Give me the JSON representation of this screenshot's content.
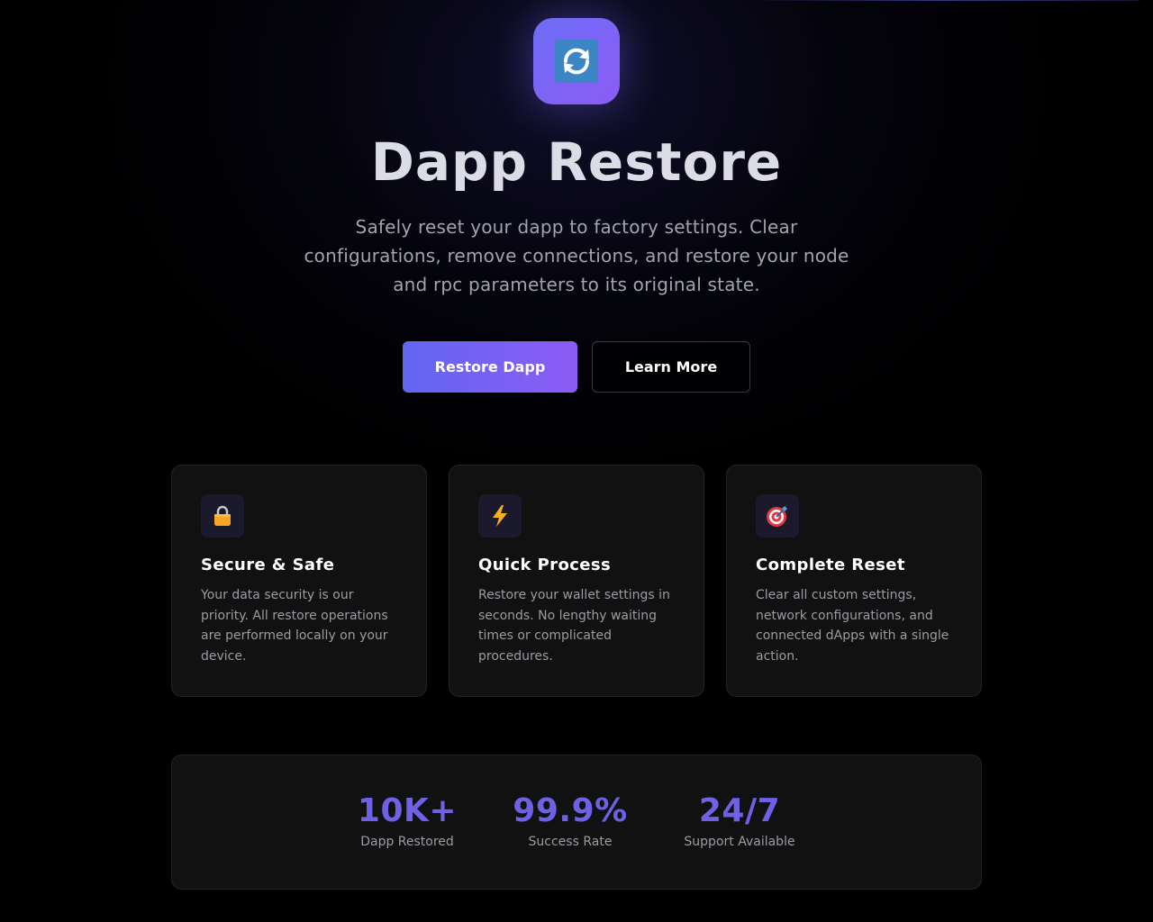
{
  "hero": {
    "logo_icon": "refresh-arrows-icon",
    "title": "Dapp Restore",
    "subtitle": "Safely reset your dapp to factory settings. Clear configurations, remove connections, and restore your node and rpc parameters to its original state.",
    "primary_button": "Restore Dapp",
    "secondary_button": "Learn More"
  },
  "features": [
    {
      "icon": "lock-icon",
      "title": "Secure & Safe",
      "description": "Your data security is our priority. All restore operations are performed locally on your device."
    },
    {
      "icon": "lightning-icon",
      "title": "Quick Process",
      "description": "Restore your wallet settings in seconds. No lengthy waiting times or complicated procedures."
    },
    {
      "icon": "target-icon",
      "title": "Complete Reset",
      "description": "Clear all custom settings, network configurations, and connected dApps with a single action."
    }
  ],
  "stats": [
    {
      "value": "10K+",
      "label": "Dapp Restored"
    },
    {
      "value": "99.9%",
      "label": "Success Rate"
    },
    {
      "value": "24/7",
      "label": "Support Available"
    }
  ],
  "colors": {
    "accent_start": "#6366f1",
    "accent_end": "#8b5cf6",
    "stat_value": "#6e61e6",
    "card_bg": "#111112",
    "background": "#000000"
  }
}
